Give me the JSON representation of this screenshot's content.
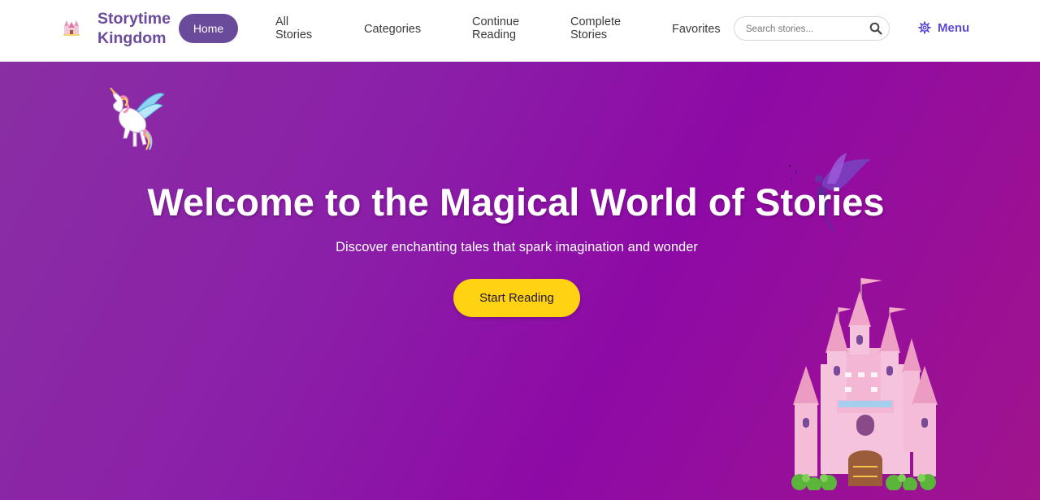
{
  "brand": {
    "name": "Storytime Kingdom",
    "logo_icon": "castle-logo-icon"
  },
  "nav": {
    "home": "Home",
    "all_stories": [
      "All",
      "Stories"
    ],
    "categories": "Categories",
    "continue_reading": [
      "Continue",
      "Reading"
    ],
    "complete_stories": [
      "Complete",
      "Stories"
    ],
    "favorites": "Favorites"
  },
  "search": {
    "placeholder": "Search stories...",
    "value": "",
    "icon": "search-icon"
  },
  "menu": {
    "label": "Menu",
    "icon": "gear-icon"
  },
  "hero": {
    "title": "Welcome to the Magical World of Stories",
    "subtitle": "Discover enchanting tales that spark imagination and wonder",
    "cta": "Start Reading",
    "decorations": [
      "unicorn-illustration",
      "fairy-illustration",
      "castle-illustration"
    ]
  },
  "colors": {
    "brand": "#6b4b9c",
    "nav_active_bg": "#6a4a9a",
    "menu_accent": "#5b4bd8",
    "hero_gradient_start": "#8a2fa4",
    "hero_gradient_end": "#a0148c",
    "cta_bg": "#ffd311"
  }
}
